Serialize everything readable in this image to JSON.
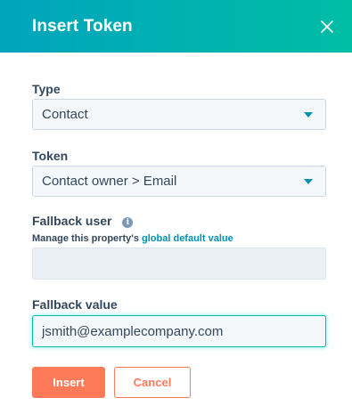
{
  "dialog": {
    "title": "Insert Token",
    "close_icon": "close-icon"
  },
  "form": {
    "type": {
      "label": "Type",
      "value": "Contact"
    },
    "token": {
      "label": "Token",
      "value": "Contact owner > Email"
    },
    "fallback_user": {
      "label": "Fallback user",
      "info_icon": "info-icon",
      "info_glyph": "i",
      "help_prefix": "Manage this property's ",
      "help_link": "global default value",
      "value": ""
    },
    "fallback_value": {
      "label": "Fallback value",
      "value": "jsmith@examplecompany.com"
    }
  },
  "actions": {
    "insert": "Insert",
    "cancel": "Cancel"
  },
  "colors": {
    "header_gradient_start": "#00a4bd",
    "header_gradient_end": "#00bda5",
    "primary": "#ff7a59",
    "link": "#0091ae",
    "text": "#33475b"
  }
}
